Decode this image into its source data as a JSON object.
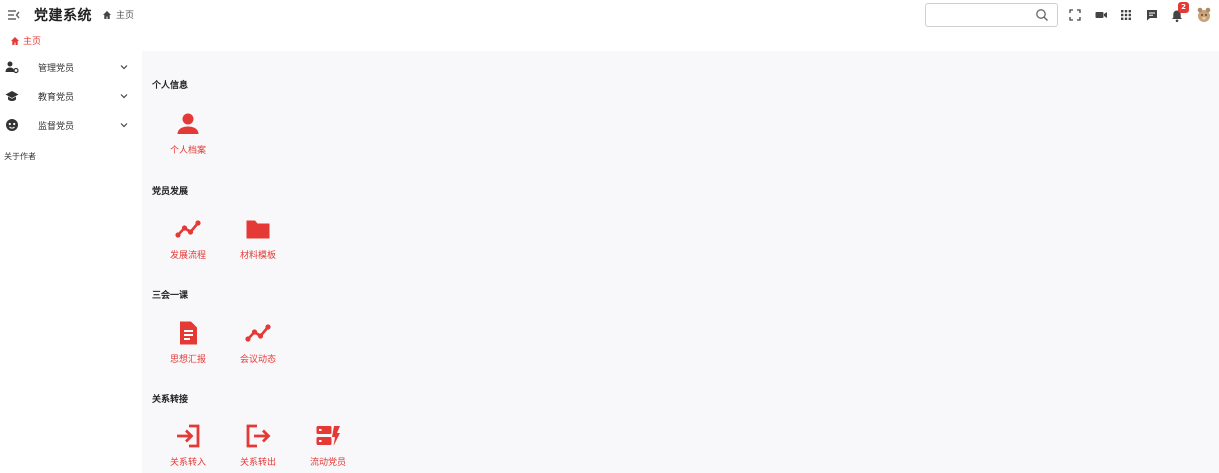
{
  "header": {
    "app_title": "党建系统",
    "home_crumb": "主页",
    "search_placeholder": "",
    "notification_count": "2"
  },
  "tabs": {
    "active_label": "主页"
  },
  "sidebar": {
    "items": [
      {
        "label": "管理党员",
        "icon": "user-cog-icon"
      },
      {
        "label": "教育党员",
        "icon": "graduation-cap-icon"
      },
      {
        "label": "监督党员",
        "icon": "face-icon"
      }
    ],
    "about": "关于作者"
  },
  "sections": [
    {
      "title": "个人信息",
      "tiles": [
        {
          "label": "个人档案",
          "icon": "person-icon"
        }
      ]
    },
    {
      "title": "党员发展",
      "tiles": [
        {
          "label": "发展流程",
          "icon": "trend-line-icon"
        },
        {
          "label": "材料模板",
          "icon": "folder-icon"
        }
      ]
    },
    {
      "title": "三会一课",
      "tiles": [
        {
          "label": "思想汇报",
          "icon": "document-icon"
        },
        {
          "label": "会议动态",
          "icon": "trend-line-icon"
        }
      ]
    },
    {
      "title": "关系转接",
      "tiles": [
        {
          "label": "关系转入",
          "icon": "login-icon"
        },
        {
          "label": "关系转出",
          "icon": "logout-icon"
        },
        {
          "label": "流动党员",
          "icon": "server-flash-icon"
        }
      ]
    }
  ],
  "colors": {
    "accent": "#e53935",
    "main_bg": "#f8f8fb"
  }
}
